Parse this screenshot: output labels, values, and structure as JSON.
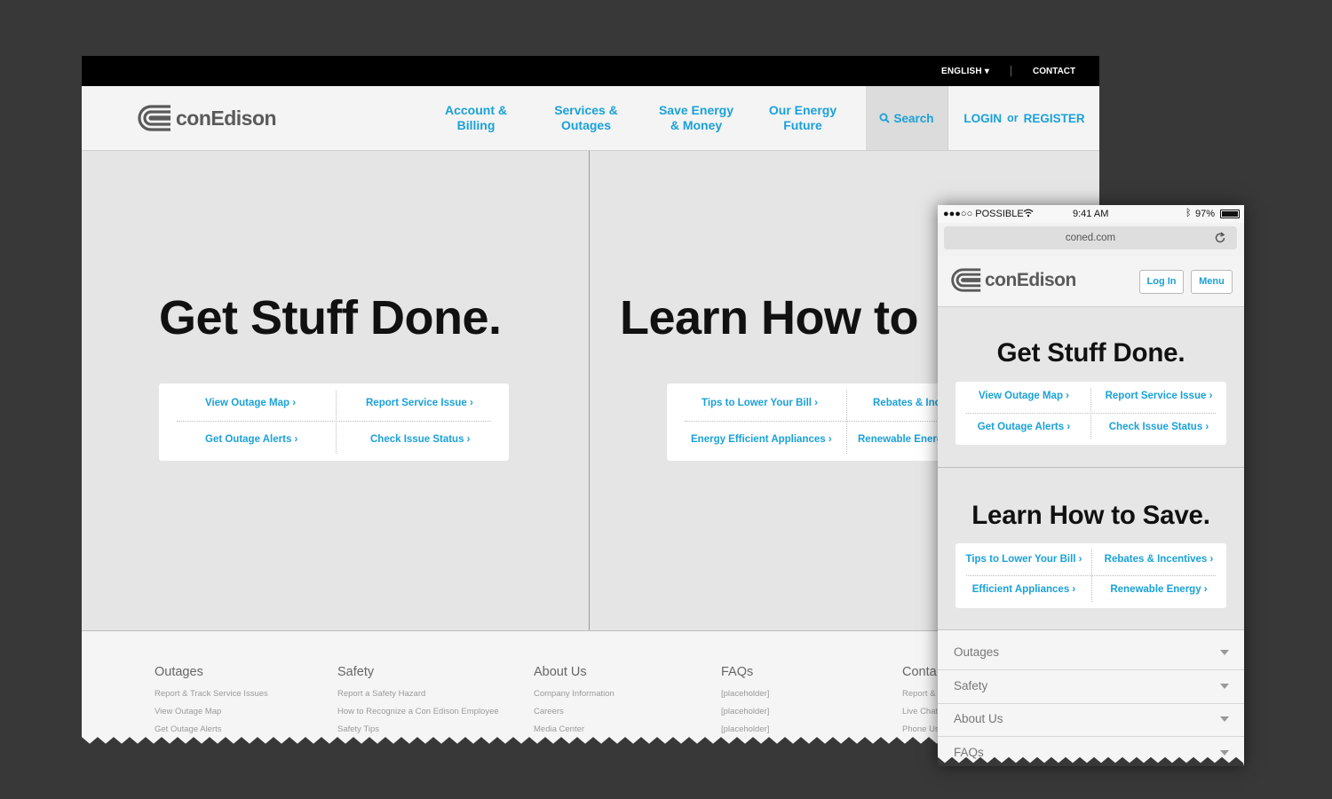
{
  "desktop": {
    "topbar": {
      "language": "ENGLISH",
      "contact": "CONTACT"
    },
    "header": {
      "logo": "conEdison",
      "nav": [
        {
          "line1": "Account &",
          "line2": "Billing"
        },
        {
          "line1": "Services &",
          "line2": "Outages"
        },
        {
          "line1": "Save Energy",
          "line2": "& Money"
        },
        {
          "line1": "Our Energy",
          "line2": "Future"
        }
      ],
      "search": "Search",
      "login": "LOGIN",
      "or": "or",
      "register": "REGISTER"
    },
    "left_panel": {
      "title": "Get Stuff Done.",
      "links": [
        "View Outage Map",
        "Report Service Issue",
        "Get Outage Alerts",
        "Check Issue Status"
      ]
    },
    "right_panel": {
      "title": "Learn How to",
      "links": [
        "Tips to Lower Your Bill",
        "Rebates & Inc",
        "Energy Efficient Appliances",
        "Renewable Energ"
      ]
    },
    "footer": {
      "columns": [
        {
          "heading": "Outages",
          "items": [
            "Report & Track Service Issues",
            "View Outage Map",
            "Get Outage Alerts"
          ]
        },
        {
          "heading": "Safety",
          "items": [
            "Report a Safety Hazard",
            "How to Recognize a Con Edison Employee",
            "Safety Tips"
          ]
        },
        {
          "heading": "About Us",
          "items": [
            "Company Information",
            "Careers",
            "Media Center"
          ]
        },
        {
          "heading": "FAQs",
          "items": [
            "[placeholder]",
            "[placeholder]",
            "[placeholder]"
          ]
        },
        {
          "heading": "Conta",
          "items": [
            "Report &",
            "Live Chat",
            "Phone Us"
          ]
        }
      ]
    }
  },
  "mobile": {
    "status": {
      "carrier": "●●●○○ POSSIBLE",
      "time": "9:41 AM",
      "battery": "97%"
    },
    "url": "coned.com",
    "logo": "conEdison",
    "login_btn": "Log In",
    "menu_btn": "Menu",
    "section1": {
      "title": "Get Stuff Done.",
      "links": [
        "View Outage Map",
        "Report Service Issue",
        "Get Outage Alerts",
        "Check Issue Status"
      ]
    },
    "section2": {
      "title": "Learn How to Save.",
      "links": [
        "Tips to Lower Your Bill",
        "Rebates & Incentives",
        "Efficient Appliances",
        "Renewable Energy"
      ]
    },
    "accordion": [
      "Outages",
      "Safety",
      "About Us",
      "FAQs"
    ]
  },
  "colors": {
    "accent": "#1aa1d8",
    "background": "#383838",
    "panel": "#e5e5e5"
  }
}
